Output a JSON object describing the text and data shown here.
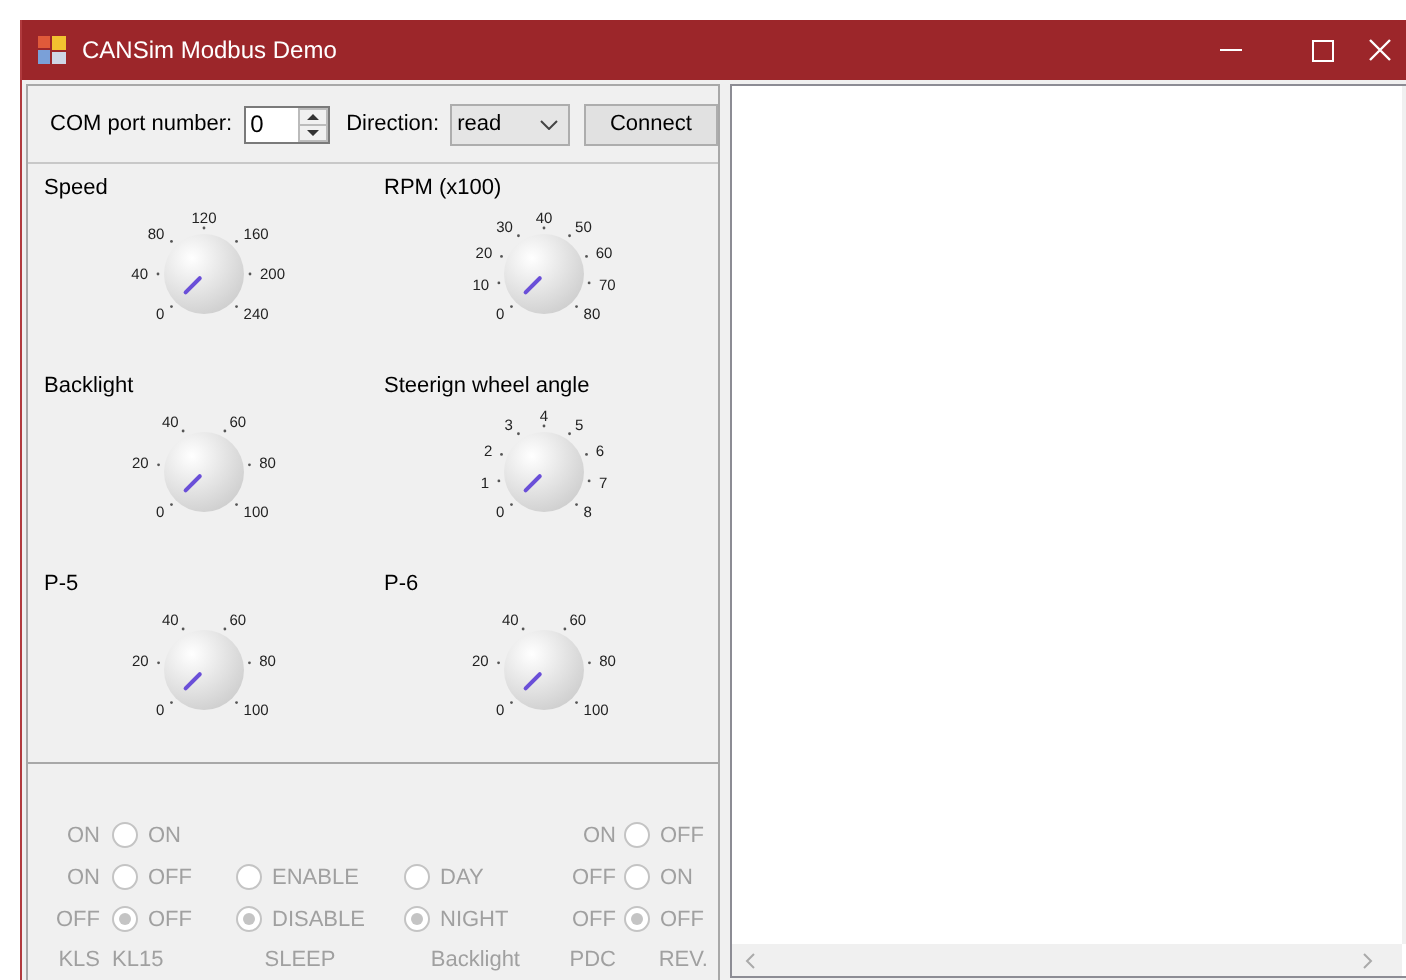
{
  "window": {
    "title": "CANSim Modbus Demo"
  },
  "connection": {
    "port_label": "COM port number:",
    "port_value": "0",
    "direction_label": "Direction:",
    "direction_value": "read",
    "connect_button": "Connect"
  },
  "gauges": [
    {
      "label": "Speed",
      "ticks": [
        "0",
        "40",
        "80",
        "120",
        "160",
        "200",
        "240"
      ]
    },
    {
      "label": "RPM (x100)",
      "ticks": [
        "0",
        "10",
        "20",
        "30",
        "40",
        "50",
        "60",
        "70",
        "80"
      ]
    },
    {
      "label": "Backlight",
      "ticks": [
        "0",
        "20",
        "40",
        "60",
        "80",
        "100"
      ]
    },
    {
      "label": "Steerign wheel angle",
      "ticks": [
        "0",
        "1",
        "2",
        "3",
        "4",
        "5",
        "6",
        "7",
        "8"
      ]
    },
    {
      "label": "P-5",
      "ticks": [
        "0",
        "20",
        "40",
        "60",
        "80",
        "100"
      ]
    },
    {
      "label": "P-6",
      "ticks": [
        "0",
        "20",
        "40",
        "60",
        "80",
        "100"
      ]
    }
  ],
  "switches": {
    "disabled": true,
    "groups": [
      {
        "kind": "labels",
        "caption": "KLS",
        "options": [
          {
            "label": "ON"
          },
          {
            "label": "ON"
          },
          {
            "label": "OFF"
          }
        ]
      },
      {
        "kind": "radios",
        "caption": "KL15",
        "options": [
          {
            "label": "ON",
            "selected": false
          },
          {
            "label": "OFF",
            "selected": false
          },
          {
            "label": "OFF",
            "selected": true
          }
        ]
      },
      {
        "kind": "radios",
        "caption": "SLEEP",
        "options": [
          {
            "label": "ENABLE",
            "selected": false
          },
          {
            "label": "DISABLE",
            "selected": true
          }
        ]
      },
      {
        "kind": "radios",
        "caption": "Backlight",
        "options": [
          {
            "label": "DAY",
            "selected": false
          },
          {
            "label": "NIGHT",
            "selected": true
          }
        ]
      },
      {
        "kind": "labels",
        "caption": "PDC",
        "options": [
          {
            "label": "ON"
          },
          {
            "label": "OFF"
          },
          {
            "label": "OFF"
          }
        ]
      },
      {
        "kind": "radios",
        "caption": "REV.",
        "options": [
          {
            "label": "OFF",
            "selected": false
          },
          {
            "label": "ON",
            "selected": false
          },
          {
            "label": "OFF",
            "selected": true
          }
        ]
      }
    ]
  }
}
